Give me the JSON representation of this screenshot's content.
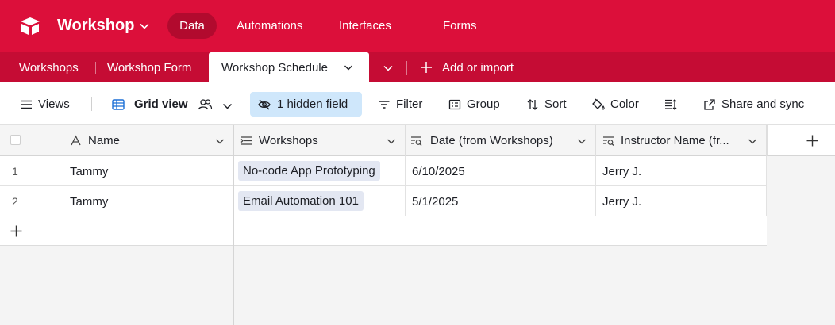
{
  "app": {
    "base_name": "Workshop",
    "nav": [
      "Data",
      "Automations",
      "Interfaces",
      "Forms"
    ],
    "brand_color": "#dc0f3a"
  },
  "tabs": {
    "items": [
      "Workshops",
      "Workshop Form",
      "Workshop Schedule"
    ],
    "active": "Workshop Schedule",
    "add_label": "Add or import"
  },
  "toolbar": {
    "views": "Views",
    "view_name": "Grid view",
    "hidden": "1 hidden field",
    "filter": "Filter",
    "group": "Group",
    "sort": "Sort",
    "color": "Color",
    "share": "Share and sync"
  },
  "grid": {
    "columns": [
      "Name",
      "Workshops",
      "Date (from Workshops)",
      "Instructor Name (fr..."
    ],
    "rows": [
      {
        "num": "1",
        "name": "Tammy",
        "workshop": "No-code App Prototyping",
        "date": "6/10/2025",
        "instructor": "Jerry J."
      },
      {
        "num": "2",
        "name": "Tammy",
        "workshop": "Email Automation 101",
        "date": "5/1/2025",
        "instructor": "Jerry J."
      }
    ]
  },
  "icons": {
    "logo": "airtable-logo",
    "views": "hamburger-icon",
    "grid": "grid-icon",
    "collaborators": "people-icon",
    "hidden": "eye-off-icon",
    "filter": "filter-icon",
    "group": "group-icon",
    "sort": "sort-icon",
    "color": "paint-bucket-icon",
    "row_height": "row-height-icon",
    "share": "share-icon"
  }
}
